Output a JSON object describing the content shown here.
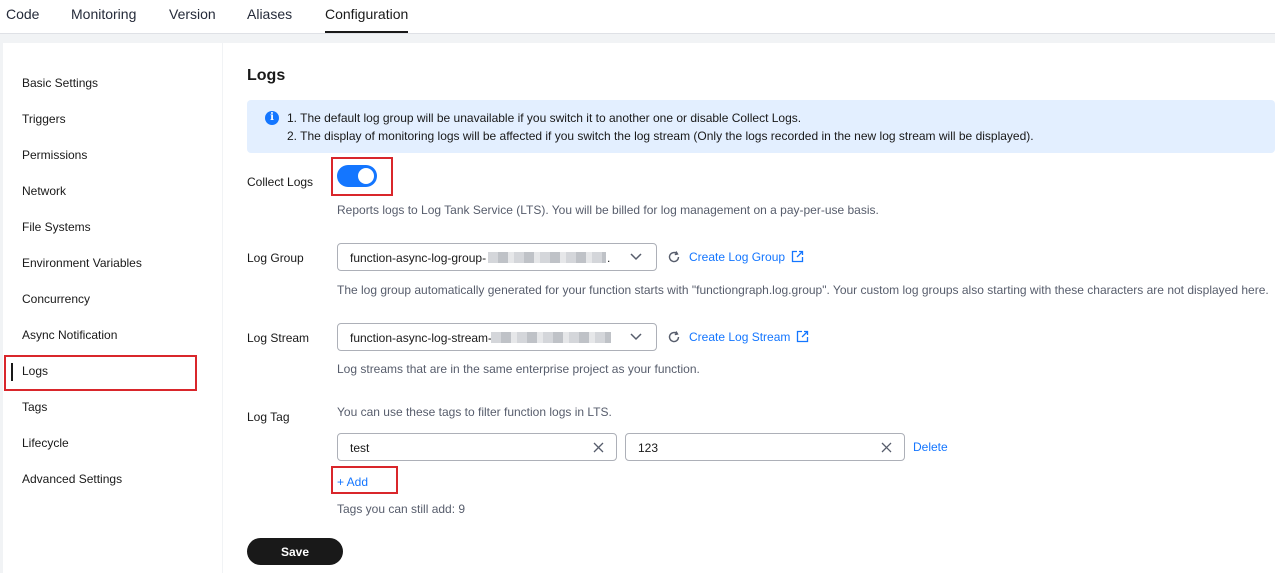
{
  "tabs": [
    {
      "label": "Code"
    },
    {
      "label": "Monitoring"
    },
    {
      "label": "Version"
    },
    {
      "label": "Aliases"
    },
    {
      "label": "Configuration",
      "active": true
    }
  ],
  "sidebar": {
    "items": [
      {
        "label": "Basic Settings"
      },
      {
        "label": "Triggers"
      },
      {
        "label": "Permissions"
      },
      {
        "label": "Network"
      },
      {
        "label": "File Systems"
      },
      {
        "label": "Environment Variables"
      },
      {
        "label": "Concurrency"
      },
      {
        "label": "Async Notification"
      },
      {
        "label": "Logs",
        "active": true
      },
      {
        "label": "Tags"
      },
      {
        "label": "Lifecycle"
      },
      {
        "label": "Advanced Settings"
      }
    ]
  },
  "main": {
    "title": "Logs",
    "notice": {
      "icon": "info-icon",
      "lines": [
        "1. The default log group will be unavailable if you switch it to another one or disable Collect Logs.",
        "2. The display of monitoring logs will be affected if you switch the log stream (Only the logs recorded in the new log stream will be displayed)."
      ]
    },
    "collect_logs": {
      "label": "Collect Logs",
      "enabled": true,
      "hint": "Reports logs to Log Tank Service (LTS). You will be billed for log management on a pay-per-use basis."
    },
    "log_group": {
      "label": "Log Group",
      "value": "function-async-log-group-",
      "value_suffix": ".",
      "create_label": "Create Log Group",
      "hint": "The log group automatically generated for your function starts with \"functiongraph.log.group\". Your custom log groups also starting with these characters are not displayed here."
    },
    "log_stream": {
      "label": "Log Stream",
      "value": "function-async-log-stream-",
      "create_label": "Create Log Stream",
      "hint": "Log streams that are in the same enterprise project as your function."
    },
    "log_tag": {
      "label": "Log Tag",
      "hint": "You can use these tags to filter function logs in LTS.",
      "tags": [
        {
          "key": "test",
          "value": "123"
        }
      ],
      "delete_label": "Delete",
      "add_label": "+ Add",
      "remaining": "Tags you can still add: 9"
    },
    "save_label": "Save"
  },
  "colors": {
    "accent": "#1476ff",
    "highlight": "#d9262b",
    "notice_bg": "#e3efff",
    "primary_button": "#191919"
  }
}
